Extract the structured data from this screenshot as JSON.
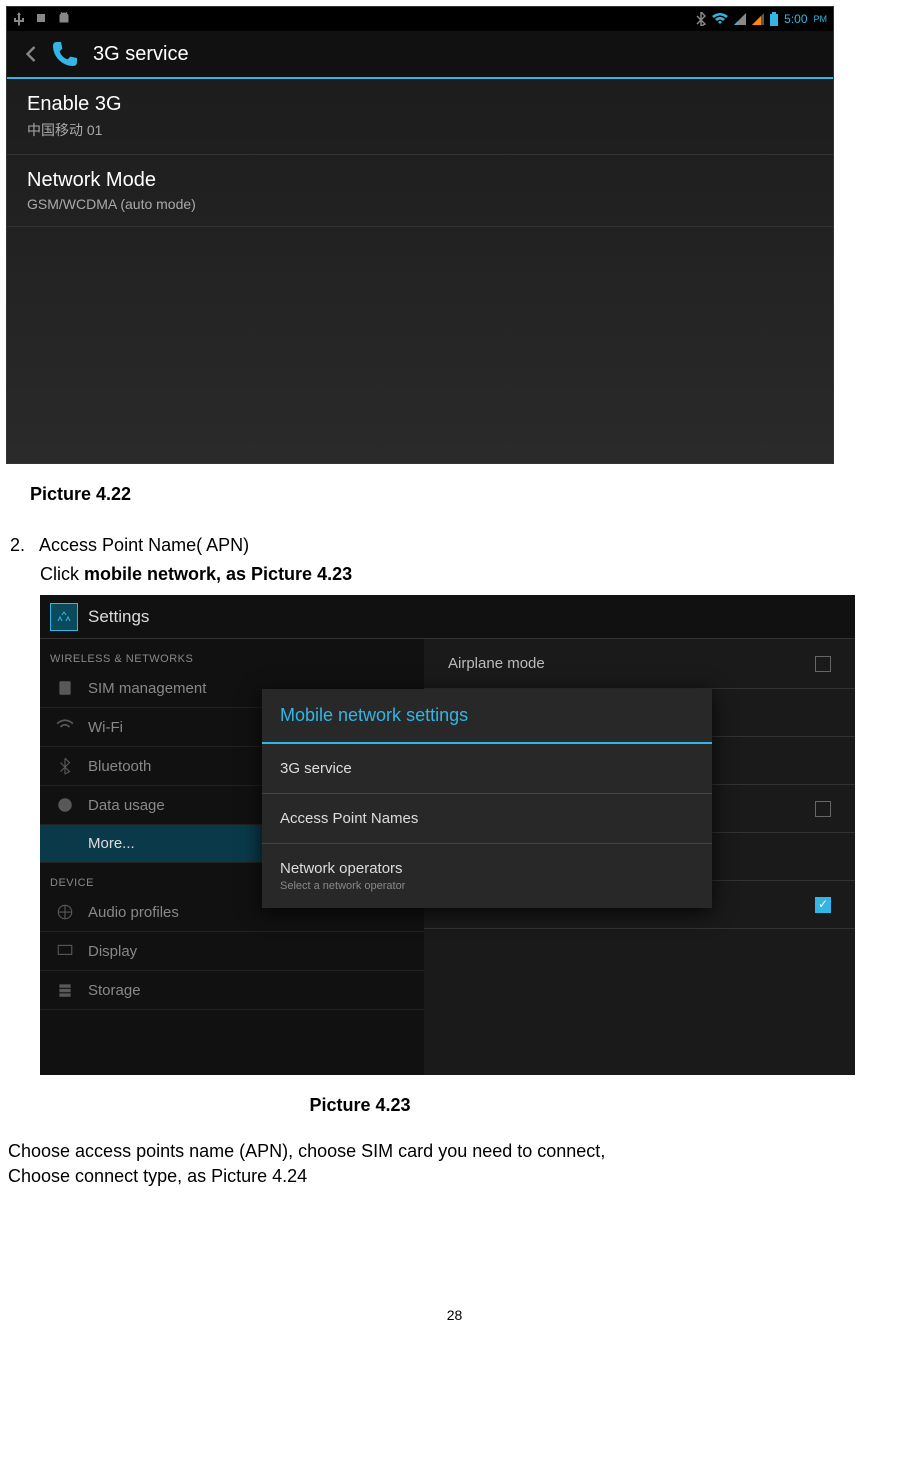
{
  "screenshot1": {
    "status": {
      "time": "5:00",
      "ampm": "PM"
    },
    "title": "3G service",
    "items": [
      {
        "main": "Enable 3G",
        "sub": "中国移动 01"
      },
      {
        "main": "Network Mode",
        "sub": "GSM/WCDMA (auto mode)"
      }
    ]
  },
  "caption1": "Picture 4.22",
  "section": {
    "num": "2.",
    "title": "Access Point Name( APN)",
    "line2_prefix": "Click ",
    "line2_bold": "mobile network, as Picture 4.23"
  },
  "screenshot2": {
    "header": "Settings",
    "sidebar": {
      "cat1": "WIRELESS & NETWORKS",
      "items1": [
        "SIM management",
        "Wi-Fi",
        "Bluetooth",
        "Data usage",
        "More..."
      ],
      "cat2": "DEVICE",
      "items2": [
        "Audio profiles",
        "Display",
        "Storage"
      ]
    },
    "right_items": [
      "Airplane mode"
    ],
    "dialog": {
      "title": "Mobile network settings",
      "items": [
        {
          "main": "3G service",
          "sub": ""
        },
        {
          "main": "Access Point Names",
          "sub": ""
        },
        {
          "main": "Network operators",
          "sub": "Select a network operator"
        }
      ]
    }
  },
  "caption2": "Picture 4.23",
  "para1": "Choose access points name (APN), choose SIM card you need to connect,",
  "para2": "Choose connect type, as Picture 4.24",
  "page_num": "28"
}
